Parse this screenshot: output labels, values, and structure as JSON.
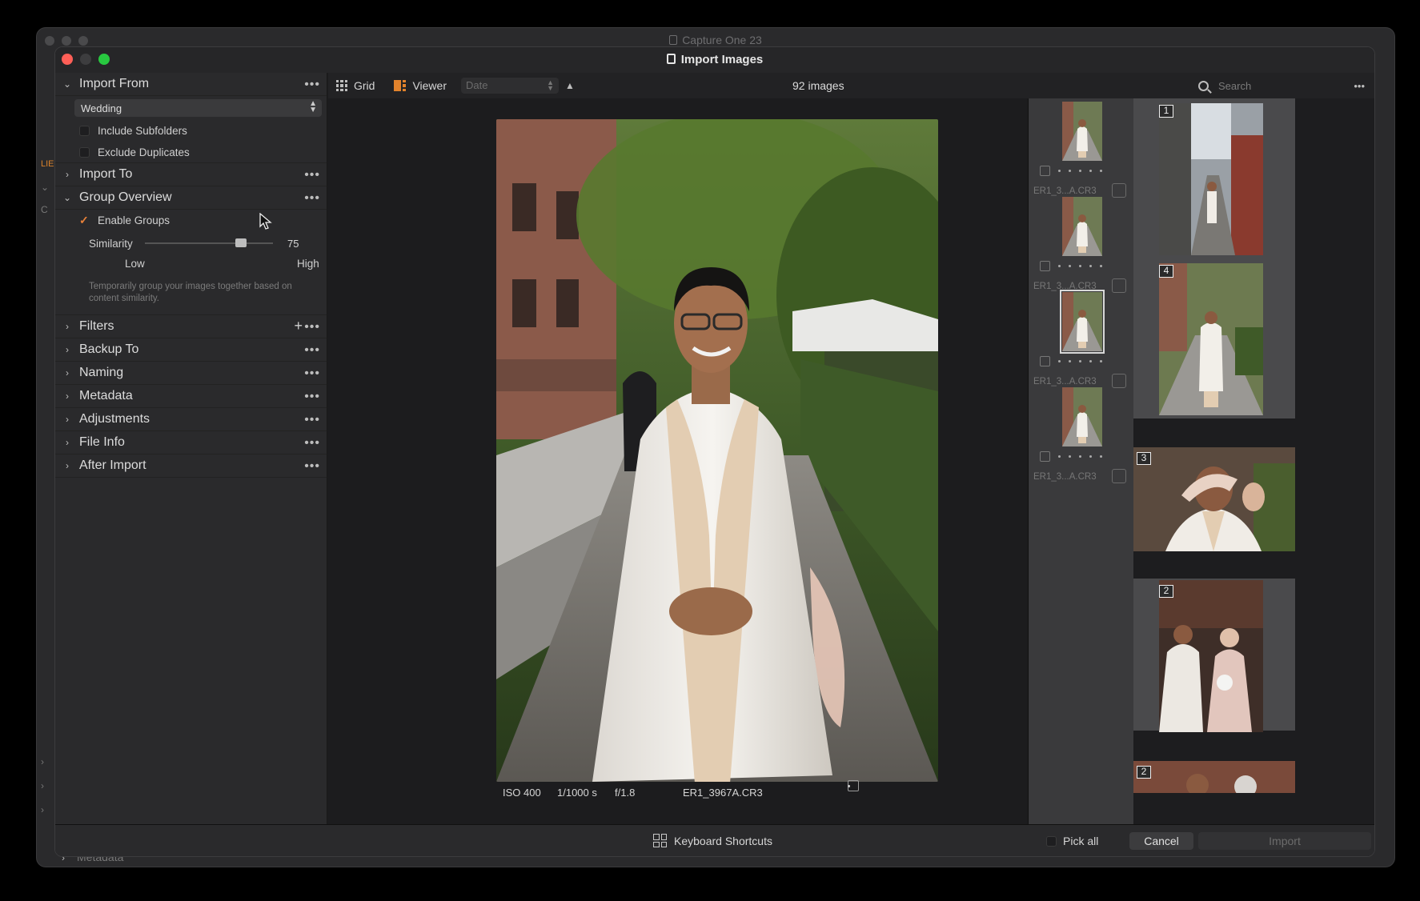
{
  "background_window": {
    "title": "Capture One 23",
    "bottom_panel_label": "Metadata"
  },
  "dialog": {
    "title": "Import Images"
  },
  "left_panel": {
    "import_from": {
      "title": "Import From",
      "source": "Wedding",
      "include_subfolders": "Include Subfolders",
      "include_subfolders_checked": false,
      "exclude_duplicates": "Exclude Duplicates",
      "exclude_duplicates_checked": false
    },
    "import_to": {
      "title": "Import To"
    },
    "group_overview": {
      "title": "Group Overview",
      "enable_groups": "Enable Groups",
      "enable_groups_checked": true,
      "similarity_label": "Similarity",
      "similarity_value": "75",
      "similarity_fraction": 0.75,
      "low": "Low",
      "high": "High",
      "hint": "Temporarily group your images together based on content similarity."
    },
    "collapsed_sections": [
      "Filters",
      "Backup To",
      "Naming",
      "Metadata",
      "Adjustments",
      "File Info",
      "After Import"
    ]
  },
  "toolbar": {
    "grid_label": "Grid",
    "viewer_label": "Viewer",
    "sort_placeholder": "Date",
    "image_count": "92 images",
    "search_placeholder": "Search"
  },
  "viewer": {
    "iso": "ISO 400",
    "shutter": "1/1000 s",
    "aperture": "f/1.8",
    "filename": "ER1_3967A.CR3"
  },
  "strip": {
    "items": [
      {
        "name": "ER1_3...A.CR3",
        "selected": false
      },
      {
        "name": "ER1_3...A.CR3",
        "selected": false
      },
      {
        "name": "ER1_3...A.CR3",
        "selected": true
      },
      {
        "name": "ER1_3...A.CR3",
        "selected": false
      }
    ]
  },
  "groups": [
    {
      "count": "1"
    },
    {
      "count": "4"
    },
    {
      "count": "3"
    },
    {
      "count": "2"
    },
    {
      "count": "2"
    }
  ],
  "footer": {
    "keyboard_shortcuts": "Keyboard Shortcuts",
    "pick_all": "Pick all",
    "cancel": "Cancel",
    "import": "Import"
  },
  "colors": {
    "accent_orange": "#e2832c",
    "close_red": "#ff5f57",
    "maximize_green": "#28c840"
  }
}
